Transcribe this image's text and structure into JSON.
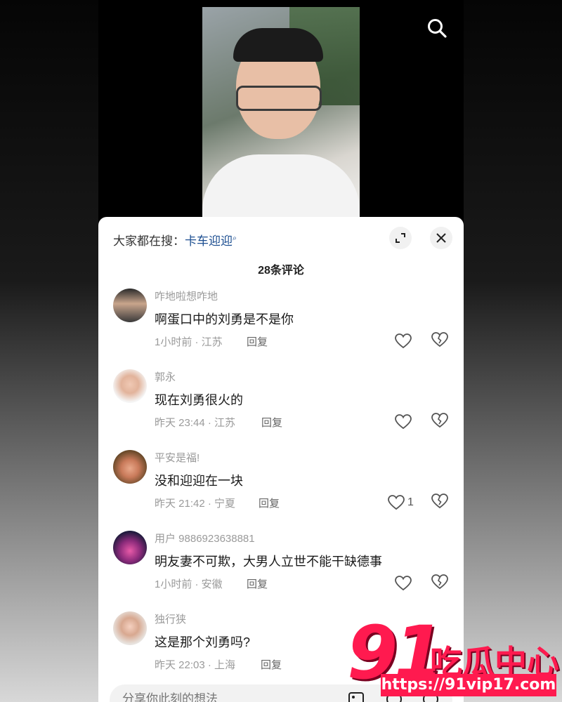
{
  "header": {
    "hot_search_prefix": "大家都在搜：",
    "hot_search_keyword": "卡车迎迎",
    "search_icon": "magnifier-icon"
  },
  "comment_count": "28条评论",
  "comments": [
    {
      "user": "咋地啦想咋地",
      "text": "啊蛋口中的刘勇是不是你",
      "time": "1小时前 · 江苏",
      "reply": "回复",
      "likes": ""
    },
    {
      "user": "郭永",
      "text": "现在刘勇很火的",
      "time": "昨天 23:44 · 江苏",
      "reply": "回复",
      "likes": ""
    },
    {
      "user": "平安是福!",
      "text": "没和迎迎在一块",
      "time": "昨天 21:42 · 宁夏",
      "reply": "回复",
      "likes": "1"
    },
    {
      "user": "用户 9886923638881",
      "text": "明友妻不可欺，大男人立世不能干缺德事",
      "time": "1小时前 · 安徽",
      "reply": "回复",
      "likes": ""
    },
    {
      "user": "独行狭",
      "text": "这是那个刘勇吗?",
      "time": "昨天 22:03 · 上海",
      "reply": "回复",
      "likes": ""
    }
  ],
  "input": {
    "placeholder": "分享你此刻的想法"
  },
  "watermark": {
    "number": "91",
    "name": "吃瓜中心",
    "url": "https://91vip17.com"
  },
  "colors": {
    "accent_link": "#1d4f91",
    "watermark": "#ff1a4f"
  }
}
